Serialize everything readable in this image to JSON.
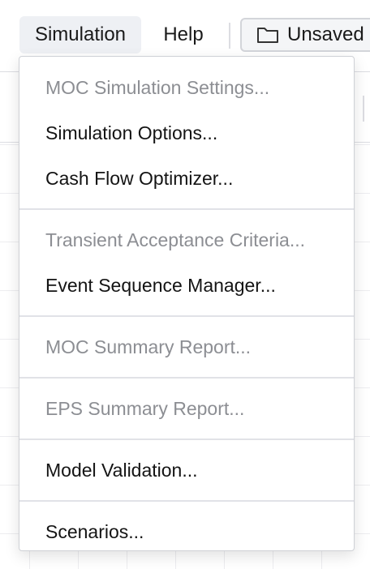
{
  "menubar": {
    "simulation_label": "Simulation",
    "help_label": "Help",
    "file_button_label": "Unsaved"
  },
  "dropdown": {
    "groups": [
      [
        {
          "label": "MOC Simulation Settings...",
          "enabled": false
        },
        {
          "label": "Simulation Options...",
          "enabled": true
        },
        {
          "label": "Cash Flow Optimizer...",
          "enabled": true
        }
      ],
      [
        {
          "label": "Transient Acceptance Criteria...",
          "enabled": false
        },
        {
          "label": "Event Sequence Manager...",
          "enabled": true
        }
      ],
      [
        {
          "label": "MOC Summary Report...",
          "enabled": false
        }
      ],
      [
        {
          "label": "EPS Summary Report...",
          "enabled": false
        }
      ],
      [
        {
          "label": "Model Validation...",
          "enabled": true
        }
      ],
      [
        {
          "label": "Scenarios...",
          "enabled": true
        }
      ]
    ]
  },
  "icons": {
    "file_button_icon": "folder-icon"
  },
  "colors": {
    "enabled_text": "#141414",
    "disabled_text": "#8c8e93",
    "active_menu_bg": "#eef0f4"
  }
}
